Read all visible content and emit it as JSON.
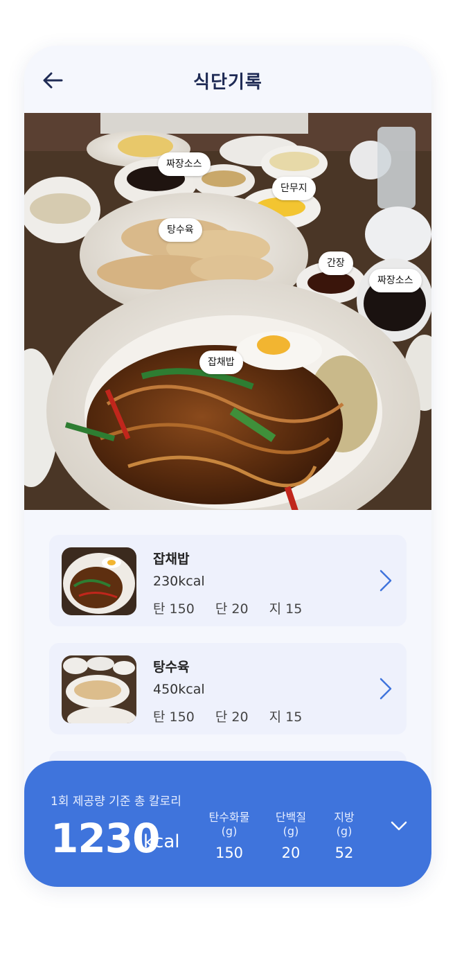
{
  "header": {
    "title": "식단기록"
  },
  "photo_tags": [
    {
      "label": "짜장소스"
    },
    {
      "label": "단무지"
    },
    {
      "label": "탕수육"
    },
    {
      "label": "간장"
    },
    {
      "label": "짜장소스"
    },
    {
      "label": "잡채밥"
    }
  ],
  "foods": [
    {
      "name": "잡채밥",
      "kcal": "230kcal",
      "carb": "탄 150",
      "protein": "단 20",
      "fat": "지 15"
    },
    {
      "name": "탕수육",
      "kcal": "450kcal",
      "carb": "탄 150",
      "protein": "단 20",
      "fat": "지 15"
    }
  ],
  "summary": {
    "label": "1회 제공량 기준 총 칼로리",
    "total": "1230",
    "unit": "kcal",
    "macros": [
      {
        "label": "탄수화물(g)",
        "value": "150"
      },
      {
        "label": "단백질(g)",
        "value": "20"
      },
      {
        "label": "지방(g)",
        "value": "52"
      }
    ]
  },
  "colors": {
    "accent": "#3f74dc",
    "title": "#1f2b55",
    "card": "#eef1fc",
    "background": "#f5f7fd"
  },
  "icons": {
    "back": "arrow-left-icon",
    "detail": "chevron-right-icon",
    "collapse": "chevron-down-icon"
  }
}
